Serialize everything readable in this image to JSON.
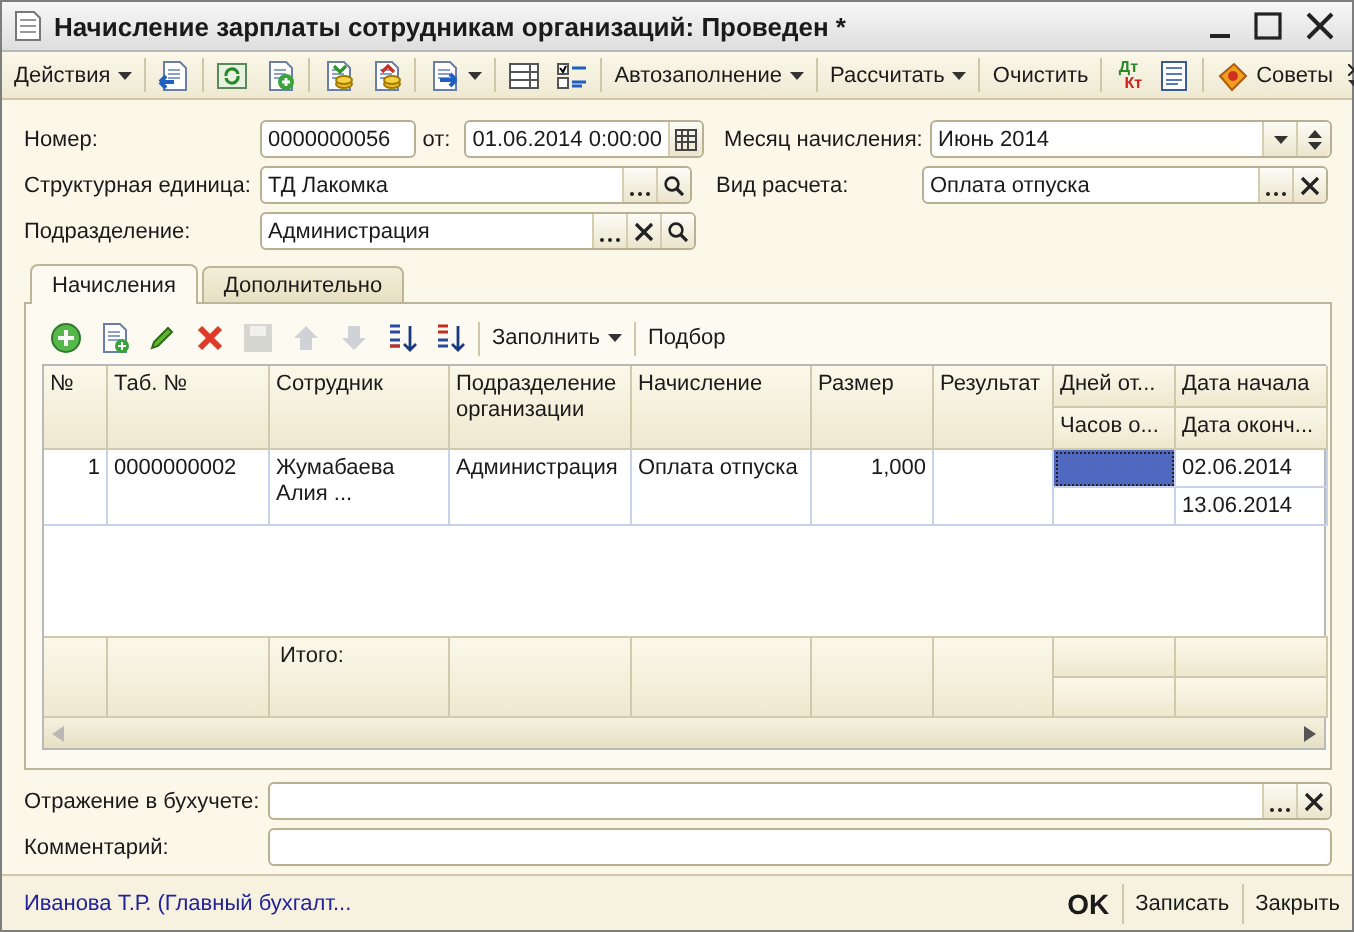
{
  "window": {
    "title": "Начисление зарплаты сотрудникам организаций: Проведен *"
  },
  "toolbar": [
    {
      "kind": "menu",
      "label": "Действия"
    },
    {
      "kind": "separator"
    },
    {
      "kind": "icon"
    },
    {
      "kind": "separator"
    },
    {
      "kind": "icon"
    },
    {
      "kind": "icon"
    },
    {
      "kind": "separator"
    },
    {
      "kind": "icon"
    },
    {
      "kind": "icon"
    },
    {
      "kind": "separator"
    },
    {
      "kind": "icon_menu"
    },
    {
      "kind": "separator"
    },
    {
      "kind": "icon"
    },
    {
      "kind": "icon"
    },
    {
      "kind": "separator"
    },
    {
      "kind": "menu",
      "label": "Автозаполнение"
    },
    {
      "kind": "separator"
    },
    {
      "kind": "menu",
      "label": "Рассчитать"
    },
    {
      "kind": "separator"
    },
    {
      "kind": "button",
      "label": "Очистить"
    },
    {
      "kind": "separator"
    },
    {
      "kind": "dtkt",
      "top": "Дт",
      "bottom": "Кт"
    },
    {
      "kind": "icon"
    },
    {
      "kind": "separator"
    },
    {
      "kind": "icon_label",
      "label": "Советы"
    },
    {
      "kind": "overflow"
    }
  ],
  "header": {
    "number": {
      "label": "Номер:",
      "value": "0000000056"
    },
    "date": {
      "label": "от:",
      "value": "01.06.2014  0:00:00"
    },
    "month": {
      "label": "Месяц начисления:",
      "value": "Июнь 2014"
    },
    "unit": {
      "label": "Структурная единица:",
      "value": "ТД Лакомка",
      "select_button": true,
      "clear_button": false,
      "search_button": true
    },
    "calc_type": {
      "label": "Вид расчета:",
      "value": "Оплата отпуска",
      "select_button": true,
      "clear_button": true,
      "search_button": false
    },
    "department": {
      "label": "Подразделение:",
      "value": "Администрация",
      "select_button": true,
      "clear_button": true,
      "search_button": true
    }
  },
  "tabs": [
    {
      "label": "Начисления",
      "selected": true
    },
    {
      "label": "Дополнительно",
      "selected": false
    }
  ],
  "table_toolbar": [
    {
      "kind": "icon",
      "disabled": false
    },
    {
      "kind": "icon",
      "disabled": false
    },
    {
      "kind": "icon",
      "disabled": false
    },
    {
      "kind": "icon",
      "disabled": false
    },
    {
      "kind": "icon",
      "disabled": true
    },
    {
      "kind": "icon",
      "disabled": true
    },
    {
      "kind": "icon",
      "disabled": true
    },
    {
      "kind": "icon",
      "disabled": false
    },
    {
      "kind": "icon",
      "disabled": false
    },
    {
      "kind": "separator"
    },
    {
      "kind": "menu",
      "label": "Заполнить"
    },
    {
      "kind": "separator"
    },
    {
      "kind": "button",
      "label": "Подбор"
    }
  ],
  "table": {
    "columns": [
      {
        "label": "№"
      },
      {
        "label": "Таб. №"
      },
      {
        "label": "Сотрудник"
      },
      {
        "label": "Подразделение организации"
      },
      {
        "label": "Начисление"
      },
      {
        "label": "Размер"
      },
      {
        "label": "Результат"
      },
      {
        "label": "Дней от...",
        "sub_label": "Часов о..."
      },
      {
        "label": "Дата начала",
        "sub_label": "Дата оконч..."
      }
    ],
    "rows": [
      {
        "cells": [
          {
            "value": "1",
            "selected": false
          },
          {
            "value": "0000000002",
            "selected": false
          },
          {
            "value": "Жумабаева Алия ...",
            "selected": false
          },
          {
            "value": "Администрация",
            "selected": false
          },
          {
            "value": "Оплата отпуска",
            "selected": false
          },
          {
            "value": "1,000",
            "selected": false
          },
          {
            "selected": false
          },
          {
            "top": {
              "selected": true
            },
            "bottom": {
              "selected": false
            }
          },
          {
            "top": {
              "value": "02.06.2014",
              "selected": false
            },
            "bottom": {
              "value": "13.06.2014",
              "selected": false
            }
          }
        ]
      }
    ],
    "totals": {
      "label": "Итого:"
    }
  },
  "accounting": {
    "label": "Отражение в бухучете:",
    "select_button": true,
    "clear_button": true,
    "search_button": false
  },
  "comment": {
    "label": "Комментарий:"
  },
  "status_bar": {
    "author": "Иванова Т.Р. (Главный бухгалт...",
    "buttons": [
      {
        "label": "OK",
        "default": true
      },
      {
        "label": "Записать",
        "default": false
      },
      {
        "label": "Закрыть",
        "default": false
      }
    ]
  }
}
